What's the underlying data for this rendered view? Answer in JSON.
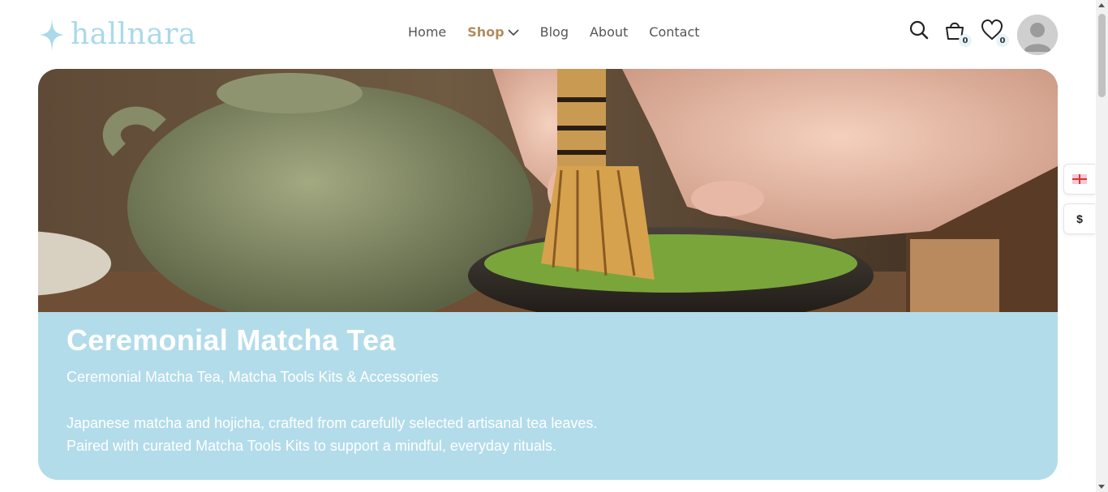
{
  "brand": {
    "name": "hallnara",
    "color": "#a9d9ea"
  },
  "nav": {
    "items": [
      {
        "label": "Home"
      },
      {
        "label": "Shop",
        "active": true,
        "has_dropdown": true
      },
      {
        "label": "Blog"
      },
      {
        "label": "About"
      },
      {
        "label": "Contact"
      }
    ],
    "accent_color": "#b08d5f"
  },
  "actions": {
    "search_icon": "search-icon",
    "cart": {
      "icon": "cart-icon",
      "count": "0"
    },
    "wishlist": {
      "icon": "heart-icon",
      "count": "0"
    },
    "avatar_icon": "user-avatar-icon"
  },
  "hero": {
    "image": "matcha-whisk-photo",
    "title": "Ceremonial Matcha Tea",
    "subtitle": "Ceremonial Matcha Tea, Matcha Tools Kits & Accessories",
    "description_line1": "Japanese matcha and hojicha, crafted from carefully selected artisanal tea leaves.",
    "description_line2": "Paired with curated Matcha Tools Kits to support a mindful, everyday rituals.",
    "panel_color": "#b3dcea"
  },
  "side_widgets": {
    "language_icon": "uk-flag-icon",
    "currency_symbol": "$"
  }
}
